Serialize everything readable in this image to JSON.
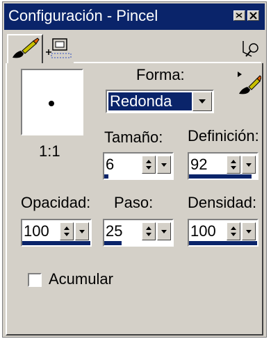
{
  "window": {
    "title": "Configuración - Pincel"
  },
  "icons": {
    "minimize": "minimize-icon",
    "close": "close-icon",
    "brush_tab": "brush-tab-icon",
    "settings_tab": "brush-settings-icon",
    "reset": "reset-icon",
    "brush_options": "brush-options-icon"
  },
  "preview": {
    "scale": "1:1"
  },
  "shape": {
    "label": "Forma:",
    "value": "Redonda"
  },
  "size": {
    "label": "Tamaño:",
    "value": "6",
    "level": 0.06
  },
  "hardness": {
    "label": "Definición:",
    "value": "92",
    "level": 0.92
  },
  "opacity": {
    "label": "Opacidad:",
    "value": "100",
    "level": 1.0
  },
  "step": {
    "label": "Paso:",
    "value": "25",
    "level": 0.25
  },
  "density": {
    "label": "Densidad:",
    "value": "100",
    "level": 1.0
  },
  "accumulate": {
    "label": "Acumular",
    "checked": false
  },
  "colors": {
    "titlebar": "#0a246a",
    "face": "#d4d0c8",
    "highlight": "#0a246a"
  }
}
